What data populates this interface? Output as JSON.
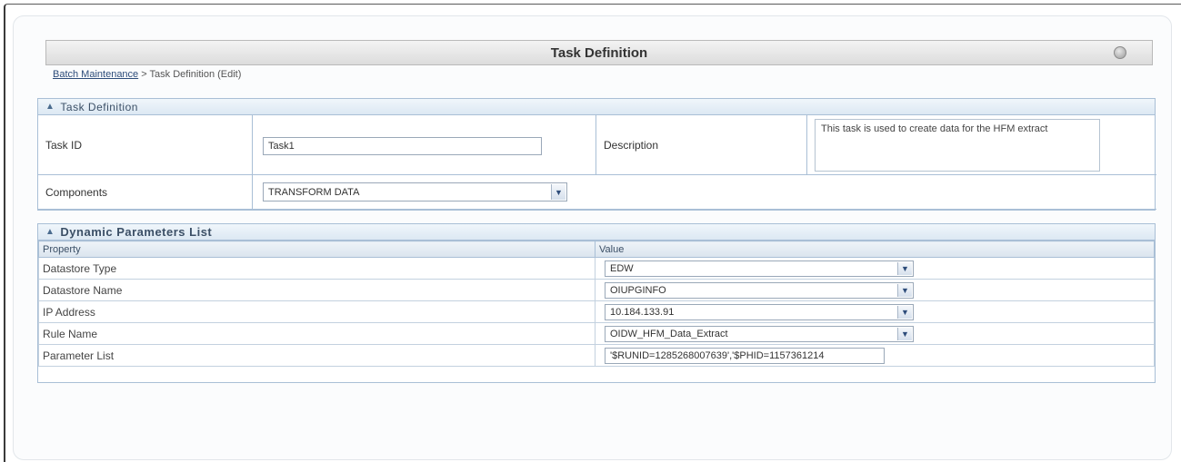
{
  "page": {
    "title": "Task Definition",
    "help_icon": "help-icon"
  },
  "breadcrumb": {
    "link": "Batch Maintenance",
    "separator": ">",
    "current": "Task Definition (Edit)"
  },
  "task_definition": {
    "section_title": "Task Definition",
    "task_id_label": "Task ID",
    "task_id_value": "Task1",
    "description_label": "Description",
    "description_value": "This task is used to create data for the HFM extract",
    "components_label": "Components",
    "components_value": "TRANSFORM DATA"
  },
  "dynamic_parameters": {
    "section_title": "Dynamic Parameters List",
    "columns": [
      "Property",
      "Value"
    ],
    "rows": [
      {
        "property": "Datastore Type",
        "value": "EDW",
        "type": "select"
      },
      {
        "property": "Datastore Name",
        "value": "OIUPGINFO",
        "type": "select"
      },
      {
        "property": "IP Address",
        "value": "10.184.133.91",
        "type": "select"
      },
      {
        "property": "Rule Name",
        "value": "OIDW_HFM_Data_Extract",
        "type": "select"
      },
      {
        "property": "Parameter List",
        "value": "'$RUNID=1285268007639','$PHID=1157361214",
        "type": "input"
      }
    ]
  },
  "colors": {
    "section_border": "#a9bfd6",
    "section_header": "#dce8f3",
    "link": "#2d4c7a"
  }
}
